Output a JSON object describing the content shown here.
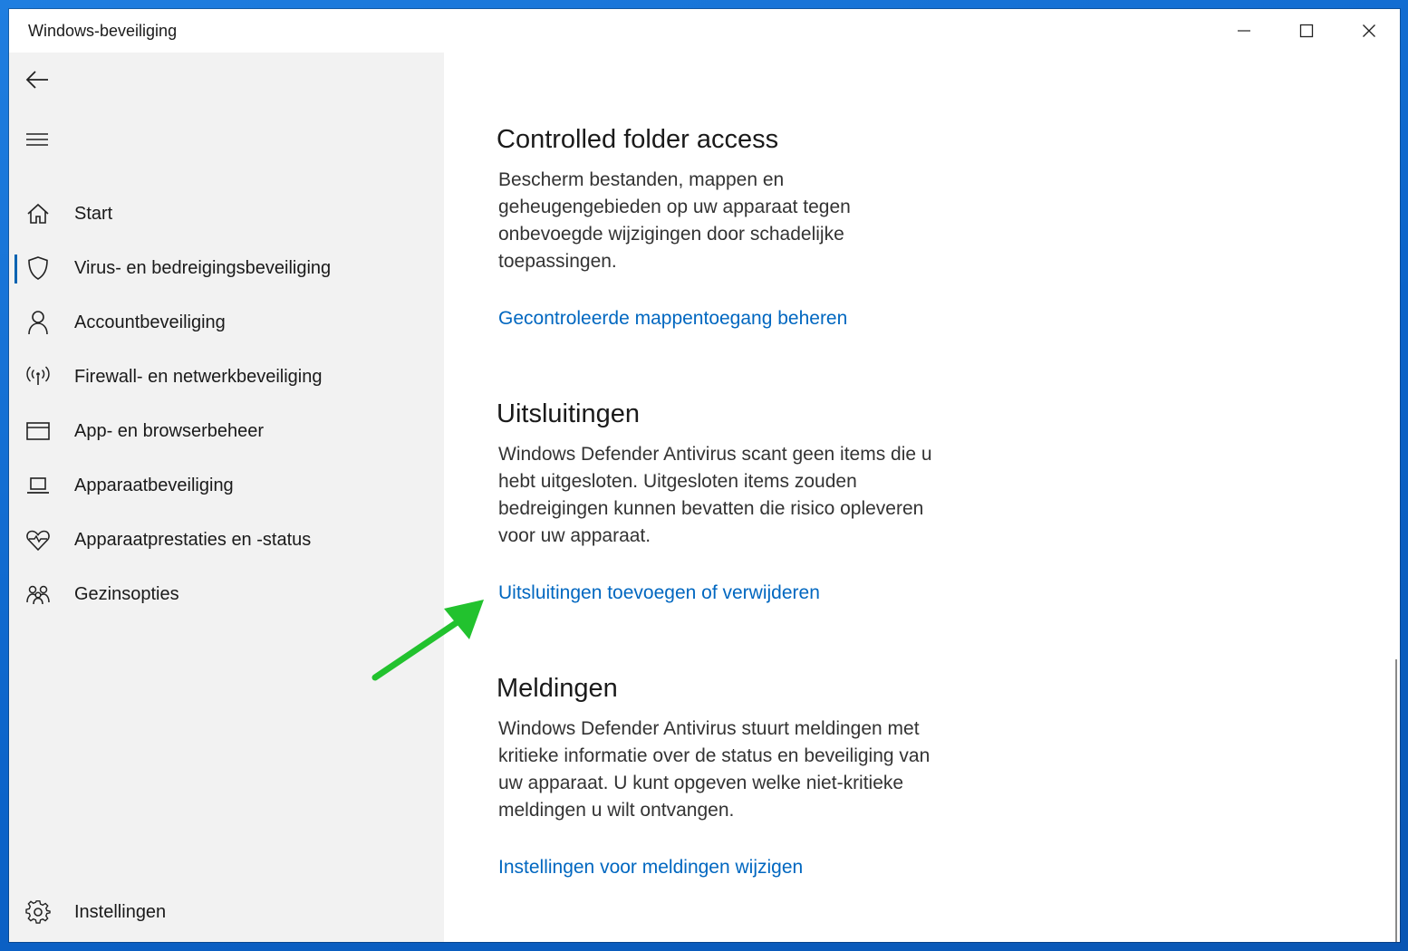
{
  "window": {
    "title": "Windows-beveiliging",
    "controls": {
      "minimize": "minimize-icon",
      "maximize": "maximize-icon",
      "close": "close-icon"
    }
  },
  "sidebar": {
    "back_icon": "back-arrow-icon",
    "menu_icon": "hamburger-menu-icon",
    "items": [
      {
        "label": "Start",
        "icon": "home-icon",
        "selected": false
      },
      {
        "label": "Virus- en bedreigingsbeveiliging",
        "icon": "shield-icon",
        "selected": true
      },
      {
        "label": "Accountbeveiliging",
        "icon": "person-icon",
        "selected": false
      },
      {
        "label": "Firewall- en netwerkbeveiliging",
        "icon": "wireless-antenna-icon",
        "selected": false
      },
      {
        "label": "App- en browserbeheer",
        "icon": "browser-window-icon",
        "selected": false
      },
      {
        "label": "Apparaatbeveiliging",
        "icon": "laptop-icon",
        "selected": false
      },
      {
        "label": "Apparaatprestaties en -status",
        "icon": "heart-pulse-icon",
        "selected": false
      },
      {
        "label": "Gezinsopties",
        "icon": "family-icon",
        "selected": false
      }
    ],
    "settings": {
      "label": "Instellingen",
      "icon": "gear-icon"
    }
  },
  "main": {
    "sections": [
      {
        "title": "Controlled folder access",
        "description": "Bescherm bestanden, mappen en geheugengebieden op uw apparaat tegen onbevoegde wijzigingen door schadelijke toepassingen.",
        "link": "Gecontroleerde mappentoegang beheren"
      },
      {
        "title": "Uitsluitingen",
        "description": "Windows Defender Antivirus scant geen items die u hebt uitgesloten. Uitgesloten items zouden bedreigingen kunnen bevatten die risico opleveren voor uw apparaat.",
        "link": "Uitsluitingen toevoegen of verwijderen"
      },
      {
        "title": "Meldingen",
        "description": "Windows Defender Antivirus stuurt meldingen met kritieke informatie over de status en beveiliging van uw apparaat. U kunt opgeven welke niet-kritieke meldingen u wilt ontvangen.",
        "link": "Instellingen voor meldingen wijzigen"
      }
    ],
    "annotation_arrow_color": "#22c22e"
  },
  "colors": {
    "accent": "#0063b1",
    "link": "#0067c0",
    "sidebar_bg": "#f2f2f2",
    "desktop": "#0b63c9"
  }
}
